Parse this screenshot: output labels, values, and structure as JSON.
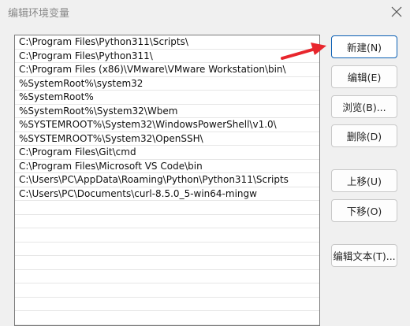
{
  "window": {
    "title": "编辑环境变量"
  },
  "path_entries": [
    "C:\\Program Files\\Python311\\Scripts\\",
    "C:\\Program Files\\Python311\\",
    "C:\\Program Files (x86)\\VMware\\VMware Workstation\\bin\\",
    "%SystemRoot%\\system32",
    "%SystemRoot%",
    "%SystemRoot%\\System32\\Wbem",
    "%SYSTEMROOT%\\System32\\WindowsPowerShell\\v1.0\\",
    "%SYSTEMROOT%\\System32\\OpenSSH\\",
    "C:\\Program Files\\Git\\cmd",
    "C:\\Program Files\\Microsoft VS Code\\bin",
    "C:\\Users\\PC\\AppData\\Roaming\\Python\\Python311\\Scripts",
    "C:\\Users\\PC\\Documents\\curl-8.5.0_5-win64-mingw"
  ],
  "buttons": {
    "new": "新建(N)",
    "edit": "编辑(E)",
    "browse": "浏览(B)...",
    "delete": "删除(D)",
    "move_up": "上移(U)",
    "move_down": "下移(O)",
    "edit_text": "编辑文本(T)..."
  },
  "colors": {
    "annotation_arrow": "#e8262d",
    "primary_border": "#0a5fb4"
  },
  "icons": {
    "close": "close-icon"
  }
}
